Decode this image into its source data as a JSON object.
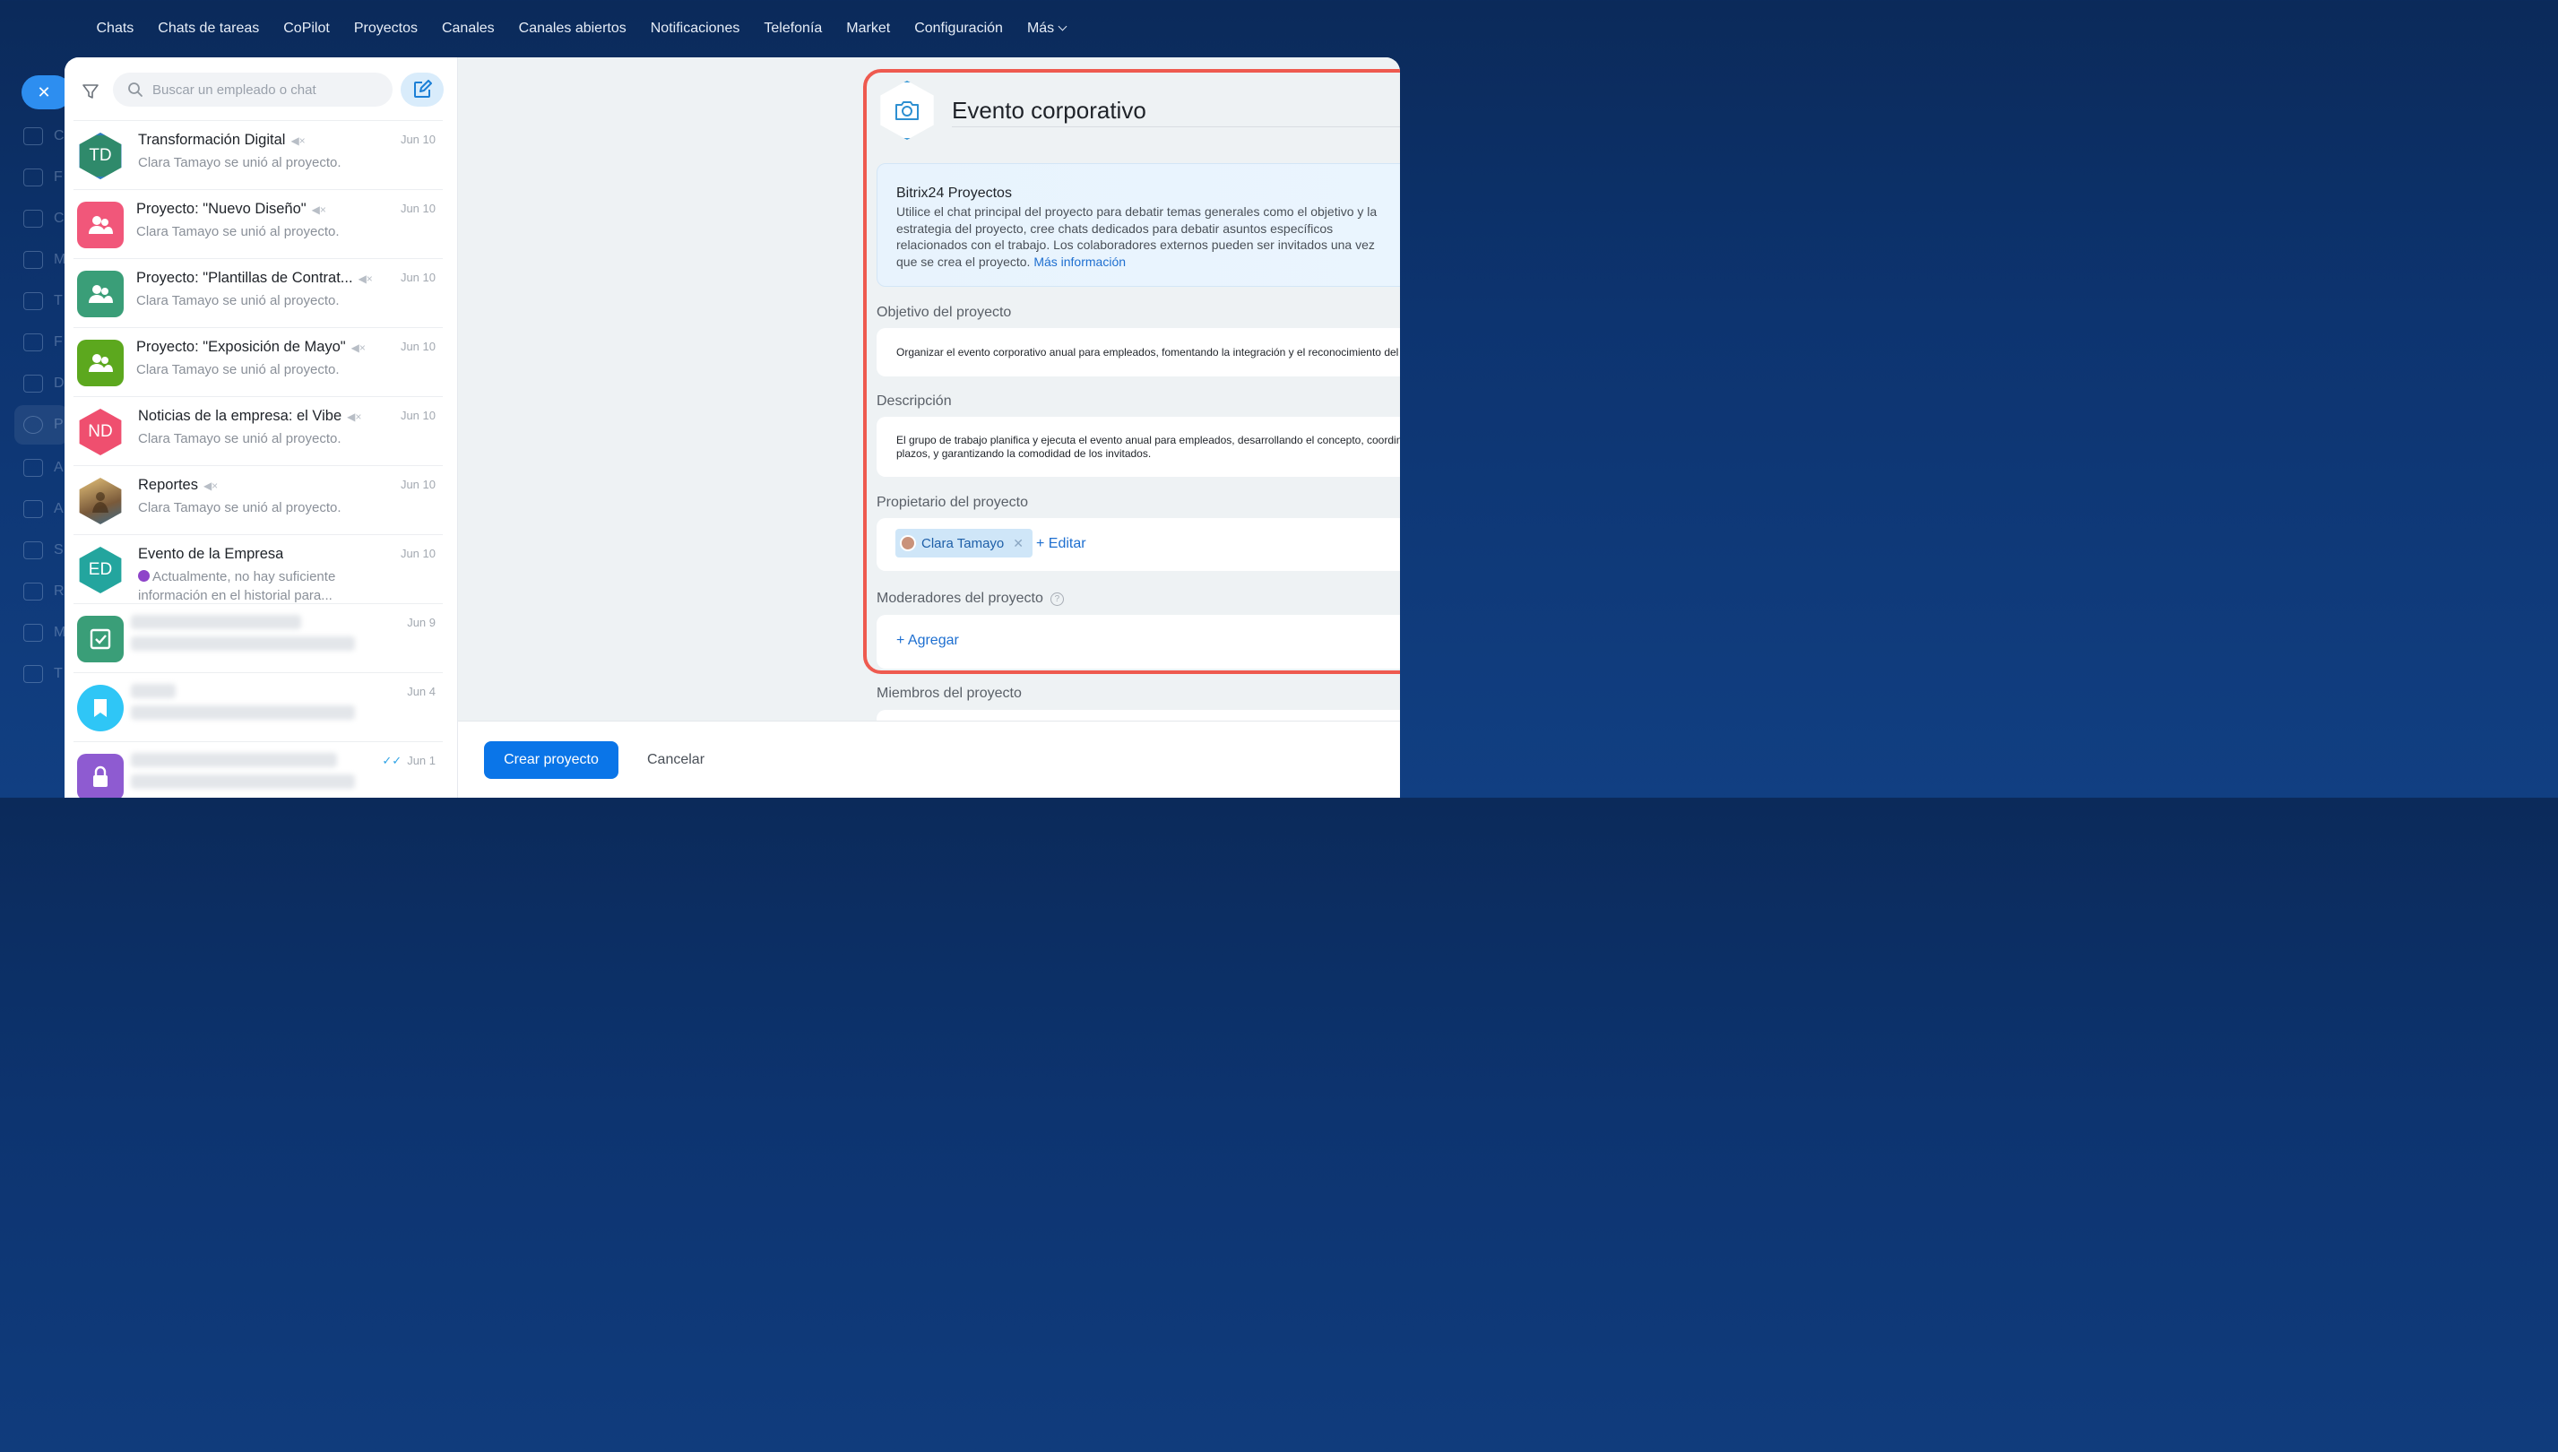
{
  "topnav": {
    "items": [
      "Chats",
      "Chats de tareas",
      "CoPilot",
      "Proyectos",
      "Canales",
      "Canales abiertos",
      "Notificaciones",
      "Telefonía",
      "Market",
      "Configuración",
      "Más"
    ]
  },
  "leftrail": {
    "letters": [
      "C",
      "F",
      "C",
      "M",
      "T",
      "F",
      "D",
      "P",
      "A",
      "A",
      "S",
      "R",
      "M",
      "T"
    ]
  },
  "search": {
    "placeholder": "Buscar un empleado o chat"
  },
  "chats": [
    {
      "initials": "TD",
      "title": "Transformación Digital",
      "muted": true,
      "date": "Jun 10",
      "subtitle": "Clara Tamayo se unió al proyecto."
    },
    {
      "initials": "",
      "title": "Proyecto: \"Nuevo Diseño\"",
      "muted": true,
      "date": "Jun 10",
      "subtitle": "Clara Tamayo se unió al proyecto."
    },
    {
      "initials": "",
      "title": "Proyecto: \"Plantillas de Contrat...",
      "muted": true,
      "date": "Jun 10",
      "subtitle": "Clara Tamayo se unió al proyecto."
    },
    {
      "initials": "",
      "title": "Proyecto: \"Exposición de Mayo\"",
      "muted": true,
      "date": "Jun 10",
      "subtitle": "Clara Tamayo se unió al proyecto."
    },
    {
      "initials": "ND",
      "title": "Noticias de la empresa: el Vibe",
      "muted": true,
      "date": "Jun 10",
      "subtitle": "Clara Tamayo se unió al proyecto."
    },
    {
      "initials": "",
      "title": "Reportes",
      "muted": true,
      "date": "Jun 10",
      "subtitle": "Clara Tamayo se unió al proyecto."
    },
    {
      "initials": "ED",
      "title": "Evento de la Empresa",
      "muted": false,
      "date": "Jun 10",
      "subtitle": "Actualmente, no hay suficiente información en el historial para..."
    },
    {
      "initials": "",
      "title": "",
      "muted": false,
      "date": "Jun 9",
      "subtitle": ""
    },
    {
      "initials": "",
      "title": "",
      "muted": false,
      "date": "Jun 4",
      "subtitle": ""
    },
    {
      "initials": "",
      "title": "",
      "muted": false,
      "date": "Jun 1",
      "subtitle": ""
    }
  ],
  "project": {
    "title": "Evento corporativo",
    "banner": {
      "heading": "Bitrix24 Proyectos",
      "text": "Utilice el chat principal del proyecto para debatir temas generales como el objetivo y la estrategia del proyecto, cree chats dedicados para debatir asuntos específicos relacionados con el trabajo. Los colaboradores externos pueden ser invitados una vez que se crea el proyecto.",
      "link": "Más información"
    },
    "objective_label": "Objetivo del proyecto",
    "objective": "Organizar el evento corporativo anual para empleados, fomentando la integración y el reconocimiento del equipo.",
    "description_label": "Descripción",
    "description": "El grupo de trabajo planifica y ejecuta el evento anual para empleados, desarrollando el concepto, coordinando la logística, organizando actividades, gestionando presupuesto y plazos, y garantizando la comodidad de los invitados.",
    "owner_label": "Propietario del proyecto",
    "owner_name": "Clara Tamayo",
    "edit_link": "+ Editar",
    "moderators_label": "Moderadores del proyecto",
    "add_link": "+ Agregar",
    "members_label": "Miembros del proyecto"
  },
  "footer": {
    "create": "Crear proyecto",
    "cancel": "Cancelar"
  },
  "colors": {
    "accent": "#0a75e8",
    "highlight": "#ee5a4f",
    "nav_bg": "#0b2a5a"
  }
}
